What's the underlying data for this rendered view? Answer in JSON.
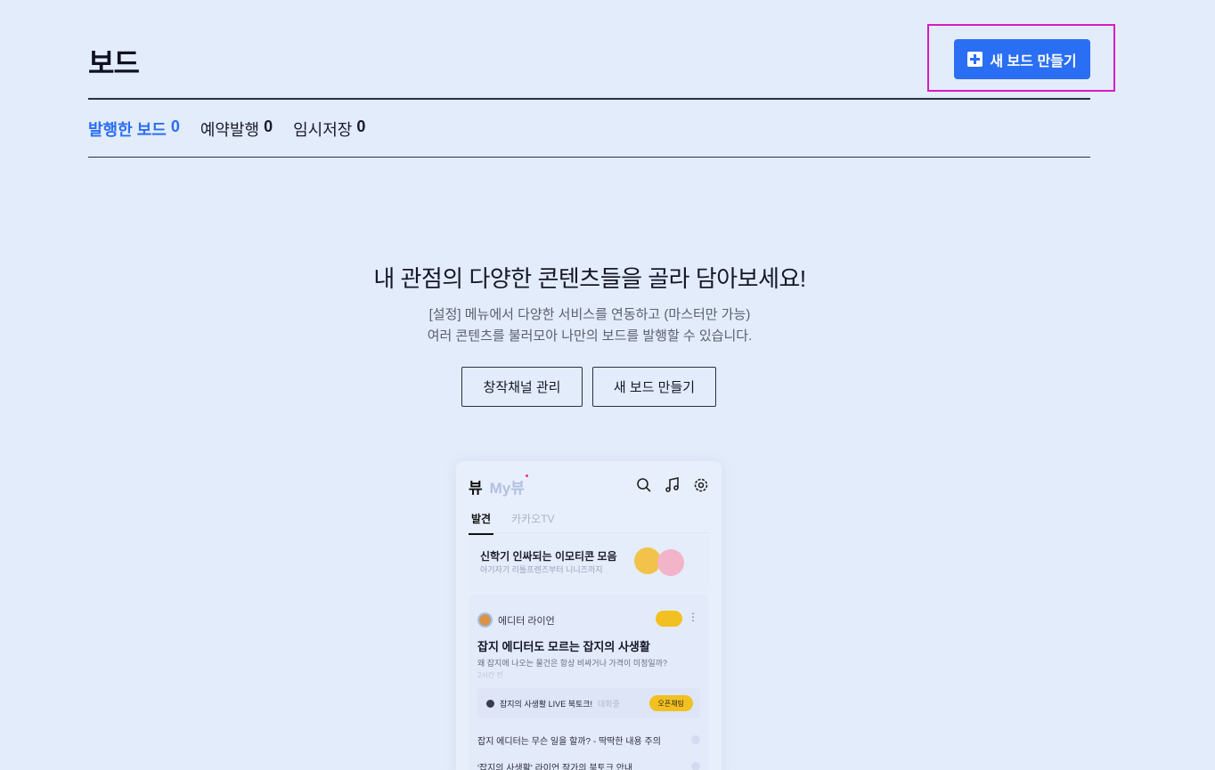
{
  "header": {
    "title": "보드",
    "new_board_button": "새 보드 만들기"
  },
  "tabs": [
    {
      "label": "발행한 보드",
      "count": "0",
      "active": true
    },
    {
      "label": "예약발행",
      "count": "0"
    },
    {
      "label": "임시저장",
      "count": "0"
    }
  ],
  "empty_state": {
    "title": "내 관점의 다양한 콘텐츠들을 골라 담아보세요!",
    "desc_line1": "[설정] 메뉴에서 다양한 서비스를 연동하고 (마스터만 가능)",
    "desc_line2": "여러 콘텐츠를 불러모아 나만의 보드를 발행할 수 있습니다.",
    "channel_button": "창작채널 관리",
    "new_board_button": "새 보드 만들기"
  },
  "preview": {
    "logo": "뷰",
    "logo_my": "My뷰",
    "tabs": [
      "발견",
      "카카오TV"
    ],
    "banner_title": "신학기 인싸되는 이모티콘 모음",
    "banner_sub": "아기자기 리틀프렌즈부터 니니즈까지",
    "author": "에디터 라이언",
    "card_title": "잡지 에디터도 모르는 잡지의 사생활",
    "card_sub": "왜 잡지에 나오는 물건은 항상 비싸거나 가격이 미정일까?",
    "card_time": "2시간 전",
    "live_label": "잡지의 사생활 LIVE 북토크!",
    "live_status": "대화중",
    "open_chat": "오픈채팅",
    "list_items": [
      "잡지 에디터는 무슨 일을 할까? - 딱딱한 내용 주의",
      "'잡지의 사생활' 라이언 작가의 북토크 안내"
    ]
  },
  "colors": {
    "background": "#e3ecfa",
    "accent": "#2a6ef3",
    "highlight": "#d61bc3"
  }
}
